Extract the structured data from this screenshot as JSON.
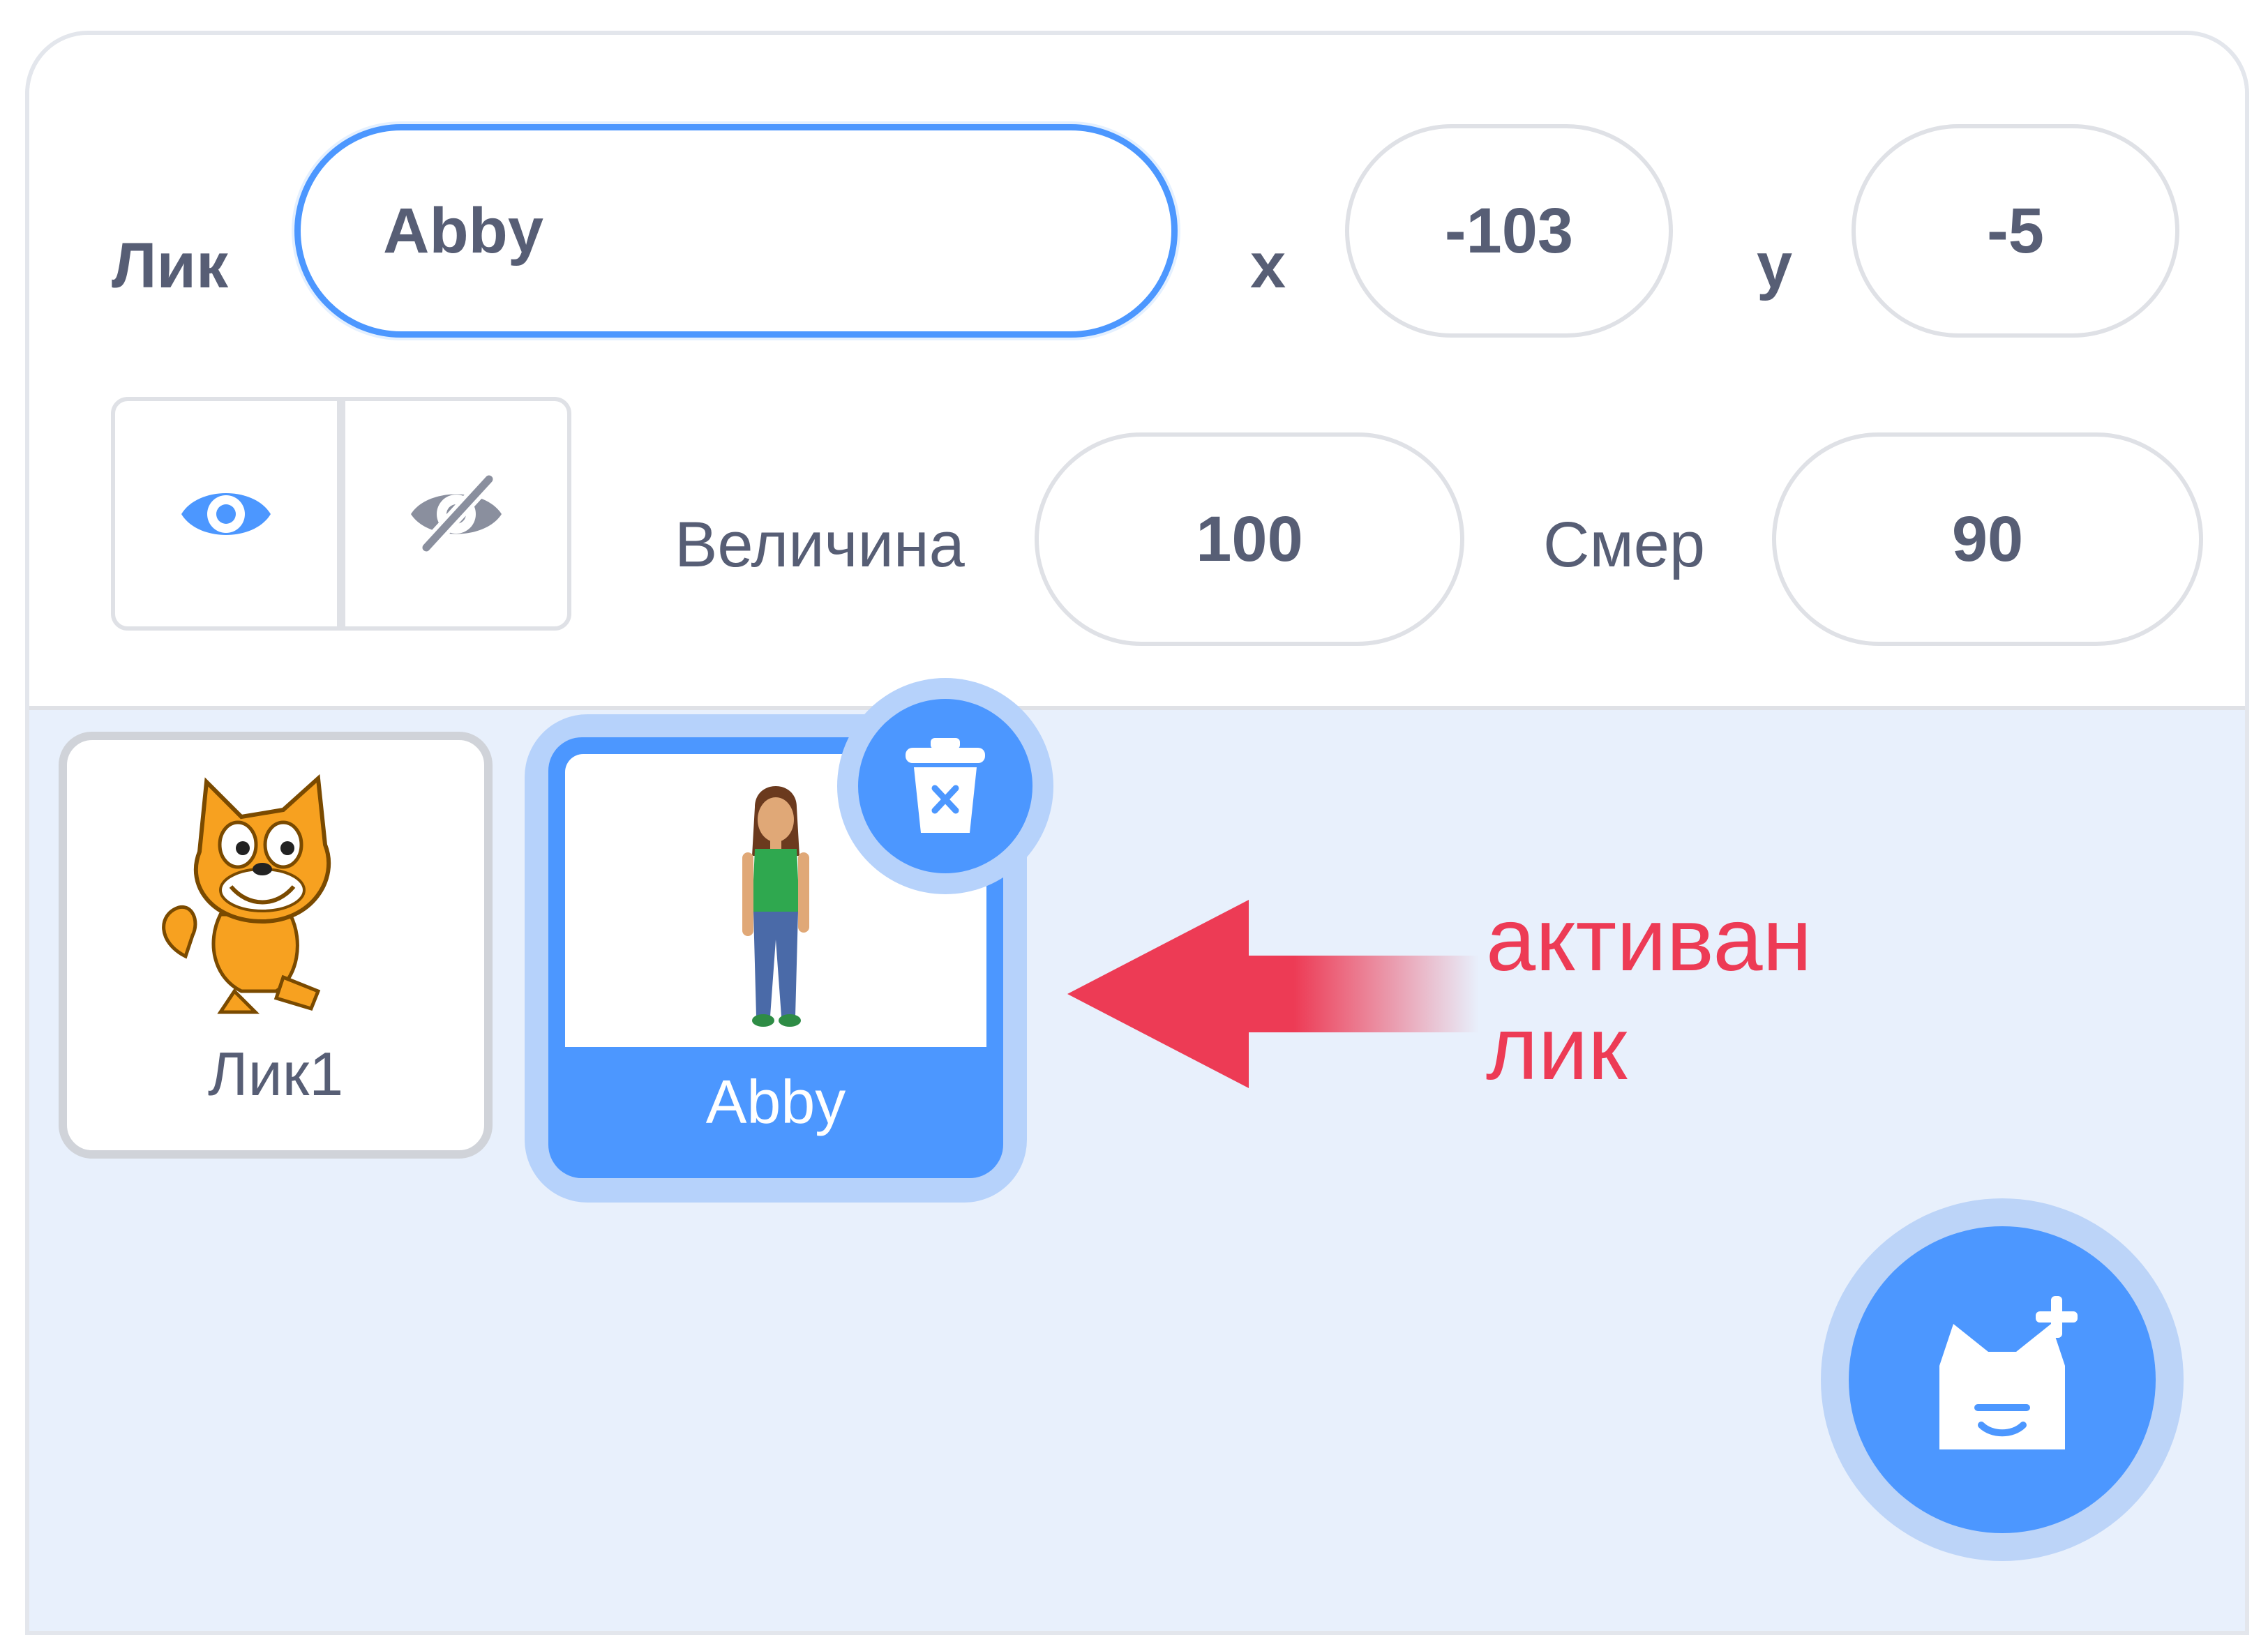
{
  "sprite_info": {
    "name_label": "Лик",
    "name_value": "Abby",
    "x_label": "x",
    "x_value": "-103",
    "y_label": "y",
    "y_value": "-5",
    "size_label": "Величина",
    "size_value": "100",
    "direction_label": "Смер",
    "direction_value": "90",
    "show_icon": "eye-icon",
    "hide_icon": "eye-crossed-icon"
  },
  "sprites": [
    {
      "name": "Лик1",
      "icon": "scratch-cat",
      "selected": false
    },
    {
      "name": "Abby",
      "icon": "abby-character",
      "selected": true
    }
  ],
  "annotation": {
    "line1": "активан",
    "line2": "лик",
    "color": "#ed3b55"
  },
  "colors": {
    "accent": "#4c97ff",
    "text": "#575e75",
    "tray_bg": "#e8f0fc"
  },
  "buttons": {
    "delete_icon": "trash-icon",
    "add_sprite_icon": "cat-plus-icon"
  }
}
